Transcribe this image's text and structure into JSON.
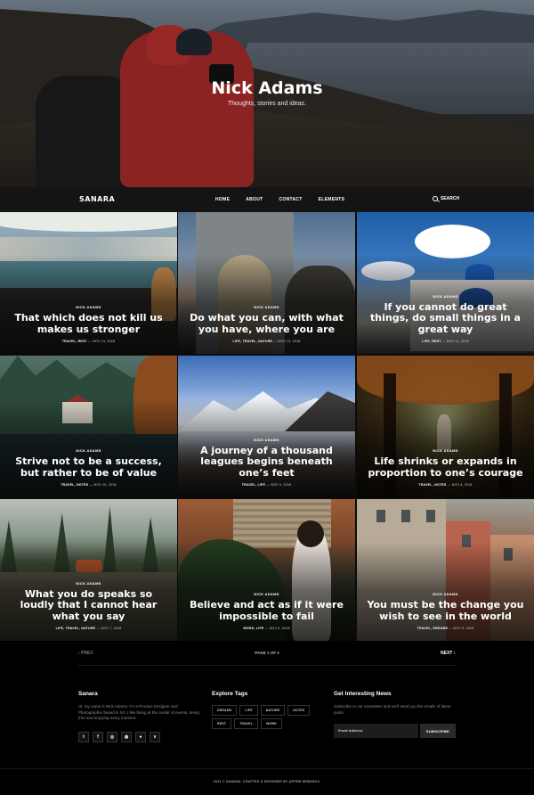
{
  "site": {
    "title": "Nick Adams",
    "tagline": "Thoughts, stories and ideas."
  },
  "nav": {
    "logo": "SANARA",
    "menu": [
      "HOME",
      "ABOUT",
      "CONTACT",
      "ELEMENTS"
    ],
    "search_label": "SEARCH"
  },
  "posts": [
    {
      "author": "NICK ADAMS",
      "title": "That which does not kill us makes us stronger",
      "tags": "TRAVEL, REST",
      "date": "NOV 13, 2018"
    },
    {
      "author": "NICK ADAMS",
      "title": "Do what you can, with what you have, where you are",
      "tags": "LIFE, TRAVEL, NATURE",
      "date": "NOV 13, 2018"
    },
    {
      "author": "NICK ADAMS",
      "title": "If you cannot do great things, do small things in a great way",
      "tags": "LIFE, REST",
      "date": "NOV 11, 2018"
    },
    {
      "author": "NICK ADAMS",
      "title": "Strive not to be a success, but rather to be of value",
      "tags": "TRAVEL, NOTES",
      "date": "NOV 10, 2018"
    },
    {
      "author": "NICK ADAMS",
      "title": "A journey of a thousand leagues begins beneath one’s feet",
      "tags": "TRAVEL, LIFE",
      "date": "NOV 9, 2018"
    },
    {
      "author": "NICK ADAMS",
      "title": "Life shrinks or expands in proportion to one’s courage",
      "tags": "TRAVEL, NOTES",
      "date": "NOV 8, 2018"
    },
    {
      "author": "NICK ADAMS",
      "title": "What you do speaks so loudly that I cannot hear what you say",
      "tags": "LIFE, TRAVEL, NATURE",
      "date": "NOV 7, 2018"
    },
    {
      "author": "NICK ADAMS",
      "title": "Believe and act as if it were impossible to fail",
      "tags": "WORK, LIFE",
      "date": "NOV 6, 2018"
    },
    {
      "author": "NICK ADAMS",
      "title": "You must be the change you wish to see in the world",
      "tags": "TRAVEL, DREAMS",
      "date": "NOV 5, 2018"
    }
  ],
  "pagination": {
    "prev": "‹ PREV",
    "page": "PAGE 1 OF 2",
    "next": "NEXT ›"
  },
  "footer": {
    "about_title": "Sanara",
    "about_text": "Hi, my name is Nick Adams. I'm a Product Designer and Photographer based in NY. I like being at the center of events, being free and enjoying every moment.",
    "social_icons": [
      "twitter-icon",
      "facebook-icon",
      "instagram-icon",
      "dribbble-icon",
      "github-icon",
      "vimeo-icon"
    ],
    "tags_title": "Explore Tags",
    "tags": [
      "DREAMS",
      "LIFE",
      "NATURE",
      "NOTES",
      "REST",
      "TRAVEL",
      "WORK"
    ],
    "news_title": "Get Interesting News",
    "news_text": "Subscribe to our newsletter and we'll send you the emails of latest posts.",
    "email_placeholder": "Email Address",
    "subscribe_label": "SUBSCRIBE",
    "copyright": "2021 © SANARA. CRAFTED & DESIGNED BY ARTEM SEMANOV."
  }
}
